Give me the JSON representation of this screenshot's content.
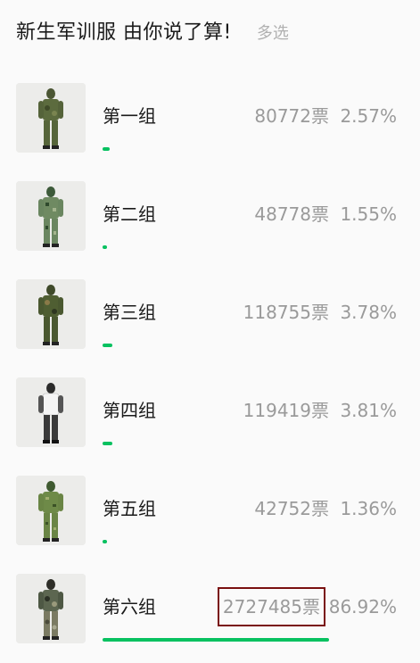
{
  "header": {
    "title": "新生军训服 由你说了算!",
    "mode": "多选"
  },
  "accent": "#07c160",
  "options": [
    {
      "label": "第一组",
      "votes": "80772票",
      "percent": "2.57%",
      "share": 0.0257,
      "uniform": "woodland-camo",
      "highlighted": false
    },
    {
      "label": "第二组",
      "votes": "48778票",
      "percent": "1.55%",
      "share": 0.0155,
      "uniform": "digital-camo",
      "highlighted": false
    },
    {
      "label": "第三组",
      "votes": "118755票",
      "percent": "3.78%",
      "share": 0.0378,
      "uniform": "woodland-camo",
      "highlighted": false
    },
    {
      "label": "第四组",
      "votes": "119419票",
      "percent": "3.81%",
      "share": 0.0381,
      "uniform": "white-and-dark",
      "highlighted": false
    },
    {
      "label": "第五组",
      "votes": "42752票",
      "percent": "1.36%",
      "share": 0.0136,
      "uniform": "digital-camo",
      "highlighted": false
    },
    {
      "label": "第六组",
      "votes": "2727485票",
      "percent": "86.92%",
      "share": 0.8692,
      "uniform": "desert-camo",
      "highlighted": true
    }
  ]
}
